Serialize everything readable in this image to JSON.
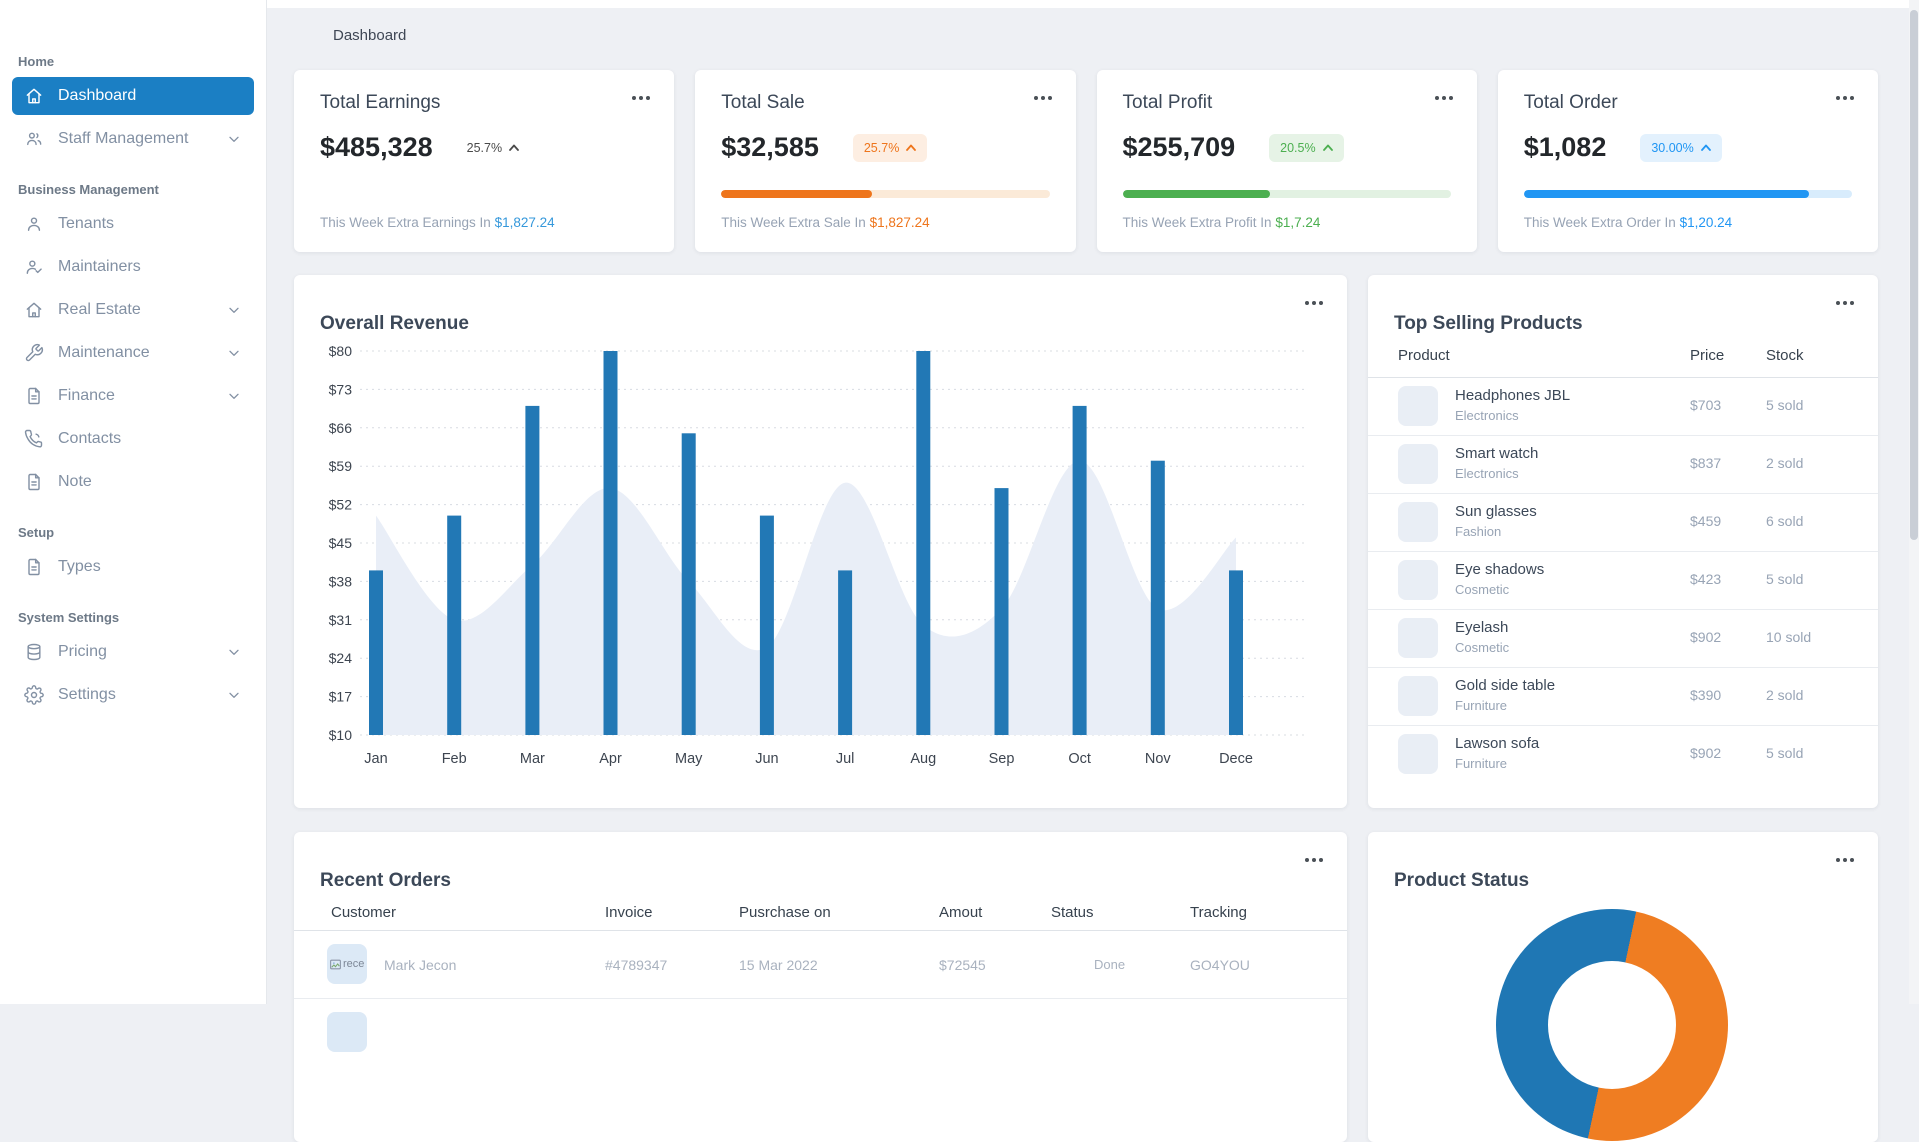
{
  "page": {
    "title": "Dashboard"
  },
  "sidebar": {
    "sections": [
      {
        "label": "Home",
        "items": [
          {
            "label": "Dashboard",
            "icon": "home-icon",
            "active": true,
            "chevron": false
          },
          {
            "label": "Staff Management",
            "icon": "users-icon",
            "active": false,
            "chevron": true
          }
        ]
      },
      {
        "label": "Business Management",
        "items": [
          {
            "label": "Tenants",
            "icon": "user-icon",
            "active": false,
            "chevron": false
          },
          {
            "label": "Maintainers",
            "icon": "user-check-icon",
            "active": false,
            "chevron": false
          },
          {
            "label": "Real Estate",
            "icon": "home-icon",
            "active": false,
            "chevron": true
          },
          {
            "label": "Maintenance",
            "icon": "wrench-icon",
            "active": false,
            "chevron": true
          },
          {
            "label": "Finance",
            "icon": "document-icon",
            "active": false,
            "chevron": true
          },
          {
            "label": "Contacts",
            "icon": "phone-icon",
            "active": false,
            "chevron": false
          },
          {
            "label": "Note",
            "icon": "document-icon",
            "active": false,
            "chevron": false
          }
        ]
      },
      {
        "label": "Setup",
        "items": [
          {
            "label": "Types",
            "icon": "document-icon",
            "active": false,
            "chevron": false
          }
        ]
      },
      {
        "label": "System Settings",
        "items": [
          {
            "label": "Pricing",
            "icon": "database-icon",
            "active": false,
            "chevron": true
          },
          {
            "label": "Settings",
            "icon": "gear-icon",
            "active": false,
            "chevron": true
          }
        ]
      }
    ]
  },
  "stat_cards": [
    {
      "title": "Total Earnings",
      "value": "$485,328",
      "change": "25.7%",
      "change_style": "plain",
      "accent": "#3598db",
      "badge_bg": "",
      "progress_pct": null,
      "track": "",
      "note_prefix": "This Week Extra Earnings In",
      "note_amount": "$1,827.24"
    },
    {
      "title": "Total Sale",
      "value": "$32,585",
      "change": "25.7%",
      "change_style": "badge",
      "accent": "#ee751c",
      "badge_bg": "#fdeee2",
      "progress_pct": 46,
      "track": "#fbead8",
      "note_prefix": "This Week Extra Sale In",
      "note_amount": "$1,827.24"
    },
    {
      "title": "Total Profit",
      "value": "$255,709",
      "change": "20.5%",
      "change_style": "badge",
      "accent": "#4caf50",
      "badge_bg": "#e6f3e6",
      "progress_pct": 45,
      "track": "#e2f1e2",
      "note_prefix": "This Week Extra Profit In",
      "note_amount": "$1,7.24"
    },
    {
      "title": "Total Order",
      "value": "$1,082",
      "change": "30.00%",
      "change_style": "badge",
      "accent": "#2196f3",
      "badge_bg": "#e3f1fd",
      "progress_pct": 87,
      "track": "#d8ecfc",
      "note_prefix": "This Week Extra Order In",
      "note_amount": "$1,20.24"
    }
  ],
  "overall_revenue": {
    "title": "Overall Revenue",
    "chart_data": {
      "type": "bar",
      "title": "Overall Revenue",
      "categories": [
        "Jan",
        "Feb",
        "Mar",
        "Apr",
        "May",
        "Jun",
        "Jul",
        "Aug",
        "Sep",
        "Oct",
        "Nov",
        "Dece"
      ],
      "series": [
        {
          "name": "revenue-bars",
          "type": "bar",
          "color": "#2278b5",
          "values": [
            40,
            50,
            70,
            80,
            65,
            50,
            40,
            80,
            55,
            70,
            60,
            40
          ]
        },
        {
          "name": "background-area",
          "type": "area",
          "color": "#e9eef7",
          "values": [
            50,
            31,
            41,
            55,
            38,
            26,
            56,
            30,
            33,
            60,
            33,
            46
          ]
        }
      ],
      "y_ticks": [
        80,
        73,
        66,
        59,
        52,
        45,
        38,
        31,
        24,
        17,
        10
      ],
      "y_tick_prefix": "$",
      "ylim": [
        10,
        80
      ],
      "xlabel": "",
      "ylabel": "",
      "grid": "dotted-horizontal",
      "legend": "none"
    }
  },
  "top_selling": {
    "title": "Top Selling Products",
    "columns": [
      "Product",
      "Price",
      "Stock"
    ],
    "products": [
      {
        "name": "Headphones JBL",
        "category": "Electronics",
        "price": "$703",
        "stock": "5 sold"
      },
      {
        "name": "Smart watch",
        "category": "Electronics",
        "price": "$837",
        "stock": "2 sold"
      },
      {
        "name": "Sun glasses",
        "category": "Fashion",
        "price": "$459",
        "stock": "6 sold"
      },
      {
        "name": "Eye shadows",
        "category": "Cosmetic",
        "price": "$423",
        "stock": "5 sold"
      },
      {
        "name": "Eyelash",
        "category": "Cosmetic",
        "price": "$902",
        "stock": "10 sold"
      },
      {
        "name": "Gold side table",
        "category": "Furniture",
        "price": "$390",
        "stock": "2 sold"
      },
      {
        "name": "Lawson sofa",
        "category": "Furniture",
        "price": "$902",
        "stock": "5 sold"
      }
    ]
  },
  "recent_orders": {
    "title": "Recent Orders",
    "columns": [
      "Customer",
      "Invoice",
      "Pusrchase on",
      "Amout",
      "Status",
      "Tracking"
    ],
    "rows": [
      {
        "avatar_alt": "rece",
        "customer": "Mark Jecon",
        "invoice": "#4789347",
        "purchase_on": "15 Mar 2022",
        "amount": "$72545",
        "status": "Done",
        "tracking": "GO4YOU"
      }
    ],
    "has_partial_second_row": true
  },
  "product_status": {
    "title": "Product Status",
    "chart_data": {
      "type": "pie",
      "subtype": "donut",
      "rotation_deg": 12,
      "segments": [
        {
          "color": "#ef7d22",
          "degrees": 180
        },
        {
          "color": "#1f77b4",
          "degrees": 180
        }
      ],
      "legend": "none"
    }
  }
}
